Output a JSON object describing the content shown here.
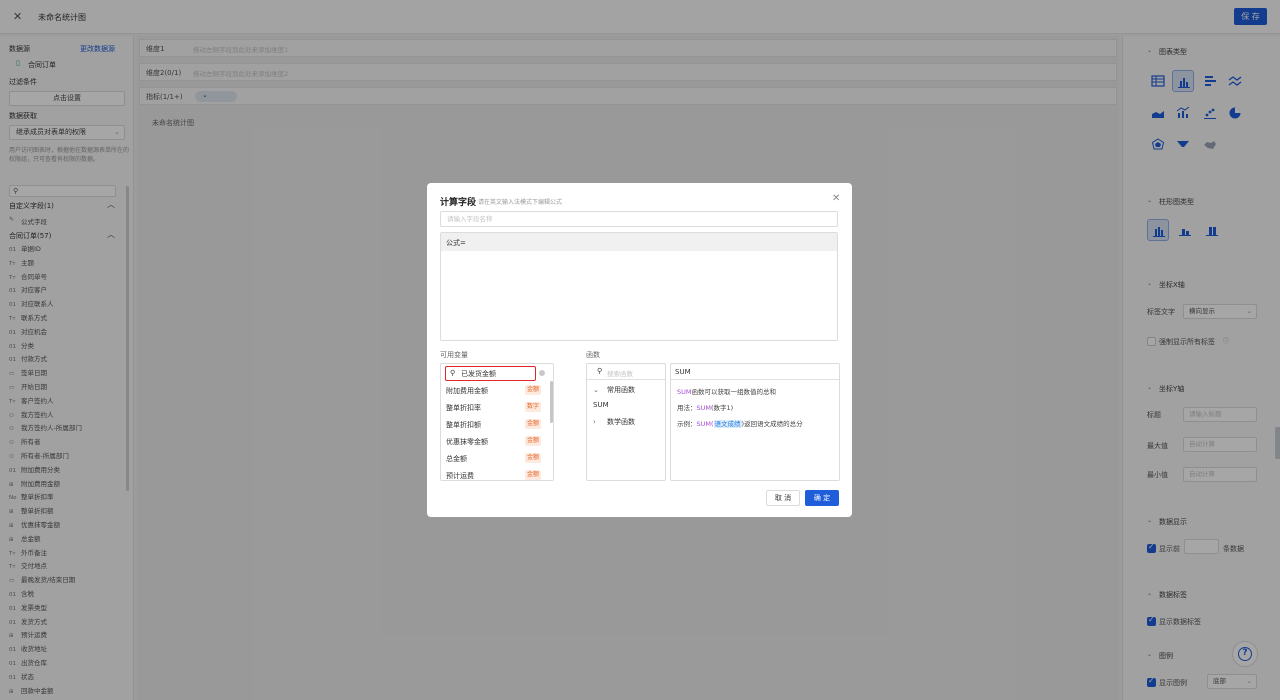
{
  "topbar": {
    "title": "未命名统计图",
    "save_label": "保 存"
  },
  "left": {
    "datasource_label": "数据源",
    "change_source_label": "更改数据源",
    "source_name": "合同订单",
    "filter_label": "过滤条件",
    "filter_button": "点击设置",
    "fetch_label": "数据获取",
    "fetch_value": "继承成员对表单的权限",
    "fetch_note": "用户访问图表时，根据他在数据源表单所在的权限组，只可查看有权限的数据。",
    "custom_group": "自定义字段(1)",
    "formula_field": "公式字段",
    "form_group": "合同订单(57)",
    "fields": [
      {
        "t": "01",
        "n": "单据ID"
      },
      {
        "t": "Tт",
        "n": "主题"
      },
      {
        "t": "Tт",
        "n": "合同单号"
      },
      {
        "t": "01",
        "n": "对应客户"
      },
      {
        "t": "01",
        "n": "对应联系人"
      },
      {
        "t": "Tт",
        "n": "联系方式"
      },
      {
        "t": "01",
        "n": "对应机会"
      },
      {
        "t": "01",
        "n": "分类"
      },
      {
        "t": "01",
        "n": "付款方式"
      },
      {
        "t": "▭",
        "n": "签单日期"
      },
      {
        "t": "▭",
        "n": "开始日期"
      },
      {
        "t": "Tт",
        "n": "客户签约人"
      },
      {
        "t": "⚇",
        "n": "我方签约人"
      },
      {
        "t": "⚇",
        "n": "我方签约人-所属部门"
      },
      {
        "t": "⚇",
        "n": "所有者"
      },
      {
        "t": "⚇",
        "n": "所有者-所属部门"
      },
      {
        "t": "01",
        "n": "附加费用分类"
      },
      {
        "t": "⊞",
        "n": "附加费用金额"
      },
      {
        "t": "No",
        "n": "整单折扣率"
      },
      {
        "t": "⊞",
        "n": "整单折扣额"
      },
      {
        "t": "⊞",
        "n": "优惠抹零金额"
      },
      {
        "t": "⊞",
        "n": "总金额"
      },
      {
        "t": "Tт",
        "n": "外币备注"
      },
      {
        "t": "Tт",
        "n": "交付地点"
      },
      {
        "t": "▭",
        "n": "最晚发货/结束日期"
      },
      {
        "t": "01",
        "n": "含税"
      },
      {
        "t": "01",
        "n": "发票类型"
      },
      {
        "t": "01",
        "n": "发货方式"
      },
      {
        "t": "⊞",
        "n": "预计运费"
      },
      {
        "t": "01",
        "n": "收货地址"
      },
      {
        "t": "01",
        "n": "出货仓库"
      },
      {
        "t": "01",
        "n": "状态"
      },
      {
        "t": "⊞",
        "n": "回款中金额"
      }
    ]
  },
  "main": {
    "dim1_label": "维度1",
    "dim1_placeholder": "拖动左侧字段到此处来添加维度1",
    "dim2_label": "维度2(0/1)",
    "dim2_placeholder": "拖动左侧字段到此处来添加维度2",
    "metric_label": "指标(1/1+)",
    "chart_title": "未命名统计图"
  },
  "right": {
    "chart_type_title": "图表类型",
    "bar_type_title": "柱形图类型",
    "x_axis_title": "坐标X轴",
    "label_text_label": "标签文字",
    "label_text_value": "横向显示",
    "force_show_labels": "强制显示所有标签",
    "y_axis_title": "坐标Y轴",
    "title_label": "标题",
    "title_placeholder": "请输入标题",
    "max_label": "最大值",
    "max_placeholder": "自动计算",
    "min_label": "最小值",
    "min_placeholder": "自动计算",
    "data_display_title": "数据显示",
    "show_top_label": "显示前",
    "show_top_suffix": "条数据",
    "data_label_title": "数据标签",
    "show_data_label": "显示数据标签",
    "legend_title": "图例",
    "show_legend": "显示图例",
    "legend_position": "底部"
  },
  "modal": {
    "title": "计算字段",
    "subtitle": "请在英文输入法模式下编辑公式",
    "name_placeholder": "请输入字段名称",
    "formula_prefix": "公式=",
    "vars_title": "可用变量",
    "var_search_value": "已发货金额",
    "variables": [
      {
        "name": "附加费用金额",
        "tag": "金额"
      },
      {
        "name": "整单折扣率",
        "tag": "数字"
      },
      {
        "name": "整单折扣额",
        "tag": "金额"
      },
      {
        "name": "优惠抹零金额",
        "tag": "金额"
      },
      {
        "name": "总金额",
        "tag": "金额"
      },
      {
        "name": "预计运费",
        "tag": "金额"
      }
    ],
    "funcs_title": "函数",
    "func_search_placeholder": "搜索函数",
    "func_group_common": "常用函数",
    "func_sum": "SUM",
    "func_group_math": "数学函数",
    "doc_head": "SUM",
    "doc_desc_fn": "SUM",
    "doc_desc": "函数可以获取一组数值的总和",
    "doc_usage_label": "用法：",
    "doc_usage_fn": "SUM",
    "doc_usage_args": "(数字1)",
    "doc_example_label": "示例：",
    "doc_example_fn": "SUM(",
    "doc_example_field": "语文成绩",
    "doc_example_rest": ")返回语文成绩的总分",
    "cancel_label": "取 消",
    "ok_label": "确 定"
  },
  "colors": {
    "accent": "#1f5ddb",
    "highlight_border": "#e0262a",
    "tag_text": "#e3672b",
    "fn_keyword": "#a54bd0"
  }
}
